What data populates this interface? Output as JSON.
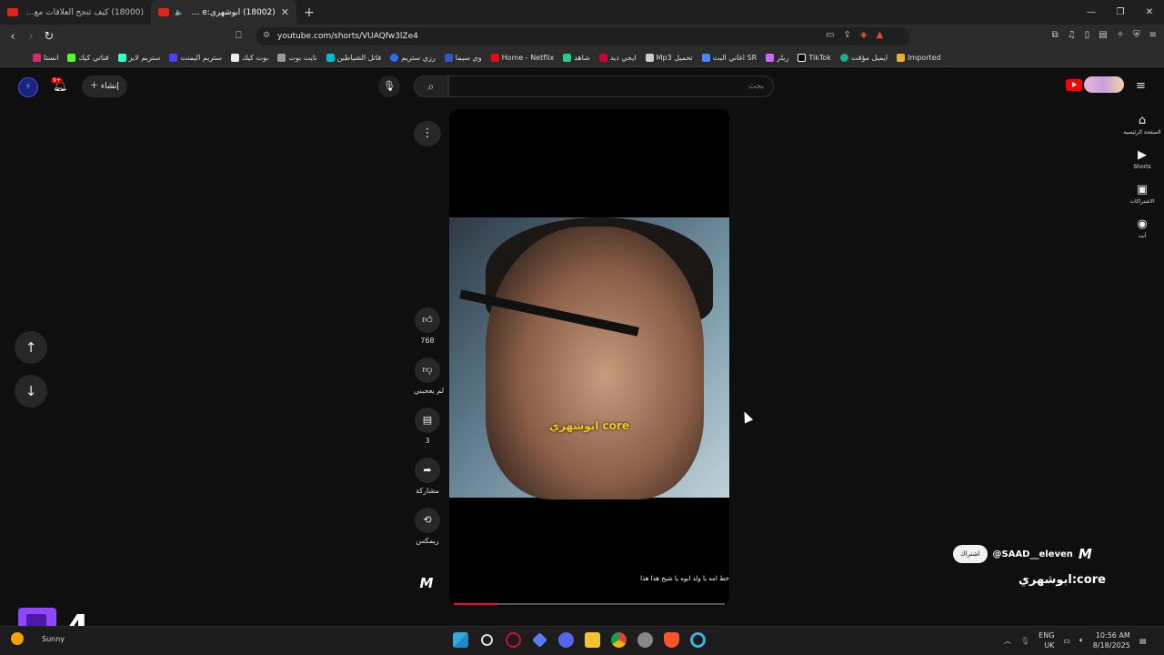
{
  "browser": {
    "tabs": [
      {
        "title": "(18000) كيف تنجح العلاقات مع ياسر الـ..."
      },
      {
        "title": "(18002) ابوشهري:YouTube - e"
      }
    ],
    "url": "youtube.com/shorts/VUAQfw3lZe4",
    "bookmarks": [
      "انستا",
      "قناتي كيك",
      "ستريم لايز",
      "ستريم اليمنت",
      "بوت كيك",
      "نايت بوت",
      "قاتل الشياطين",
      "رزي ستريم",
      "وي سيما",
      "Home - Netflix",
      "شاهد",
      "ايجي ديد",
      "Mp3 تحميل",
      "اغاني البث SR",
      "ريلز",
      "TikTok",
      "ايميل مؤقت",
      "Imported"
    ],
    "window_controls": [
      "—",
      "❐",
      "✕"
    ]
  },
  "youtube": {
    "create_label": "إنشاء",
    "notification_badge": "9+",
    "search_placeholder": "بحث",
    "guide": [
      {
        "label": "الصفحة الرئيسية",
        "icon": "home-icon",
        "glyph": "⌂"
      },
      {
        "label": "Shorts",
        "icon": "shorts-icon",
        "glyph": "▶"
      },
      {
        "label": "الاشتراكات",
        "icon": "subscriptions-icon",
        "glyph": "▣"
      },
      {
        "label": "أنت",
        "icon": "you-icon",
        "glyph": "◉"
      }
    ],
    "short": {
      "caption": "ابوشهري core",
      "subtitle": "خط امه يا ولد ابوه يا شيخ هذا هذا",
      "progress": 0.16
    },
    "actions": {
      "like_count": "768",
      "dislike_label": "لم يعجبني",
      "comment_count": "3",
      "share_label": "مشاركة",
      "remix_label": "ريمكس"
    },
    "channel": {
      "handle": "@SAAD__eleven",
      "subscribe_label": "اشتراك",
      "logo_text": "M"
    },
    "video_title": "ابوشهري:core"
  },
  "taskbar": {
    "weather": "Sunny",
    "temp": "—",
    "lang": "ENG",
    "region": "UK",
    "time": "10:56 AM",
    "date": "8/18/2025"
  },
  "overlay": {
    "number": "4"
  }
}
